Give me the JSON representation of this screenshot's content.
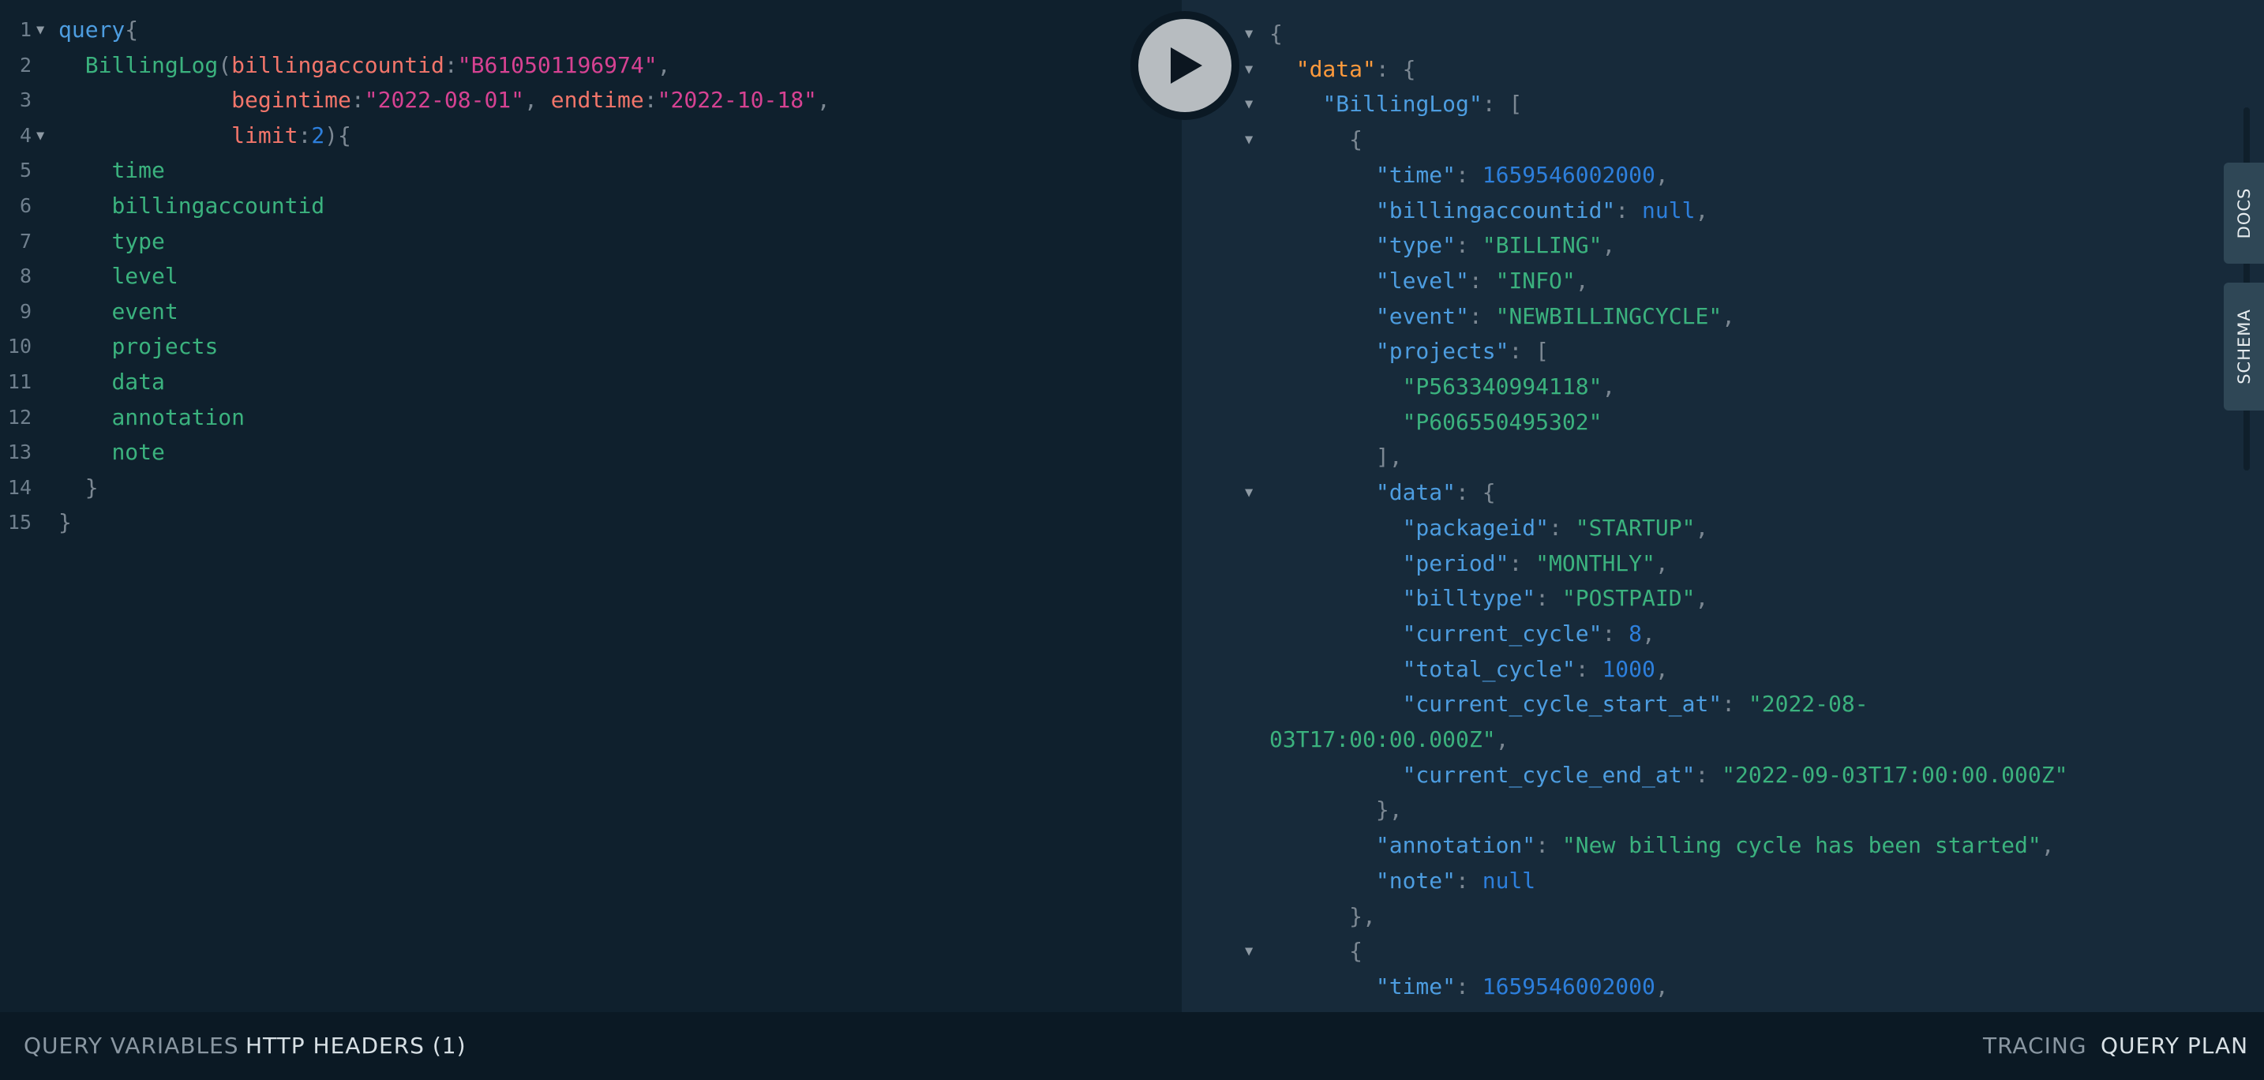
{
  "editor": {
    "lines": [
      {
        "n": "1",
        "fold": true,
        "tokens": [
          [
            "query",
            "c-key"
          ],
          [
            "{",
            "c-punc"
          ]
        ]
      },
      {
        "n": "2",
        "fold": false,
        "tokens": [
          [
            "  ",
            ""
          ],
          [
            "BillingLog",
            "c-op"
          ],
          [
            "(",
            "c-punc"
          ],
          [
            "billingaccountid",
            "c-arg"
          ],
          [
            ":",
            "c-punc"
          ],
          [
            "\"B610501196974\"",
            "c-str"
          ],
          [
            ",",
            "c-punc"
          ]
        ]
      },
      {
        "n": "3",
        "fold": false,
        "tokens": [
          [
            "             ",
            ""
          ],
          [
            "begintime",
            "c-arg"
          ],
          [
            ":",
            "c-punc"
          ],
          [
            "\"2022-08-01\"",
            "c-str"
          ],
          [
            ", ",
            "c-punc"
          ],
          [
            "endtime",
            "c-arg"
          ],
          [
            ":",
            "c-punc"
          ],
          [
            "\"2022-10-18\"",
            "c-str"
          ],
          [
            ",",
            "c-punc"
          ]
        ]
      },
      {
        "n": "4",
        "fold": true,
        "tokens": [
          [
            "             ",
            ""
          ],
          [
            "limit",
            "c-arg"
          ],
          [
            ":",
            "c-punc"
          ],
          [
            "2",
            "c-num"
          ],
          [
            "){",
            "c-punc"
          ]
        ]
      },
      {
        "n": "5",
        "fold": false,
        "tokens": [
          [
            "    ",
            ""
          ],
          [
            "time",
            "c-field"
          ]
        ]
      },
      {
        "n": "6",
        "fold": false,
        "tokens": [
          [
            "    ",
            ""
          ],
          [
            "billingaccountid",
            "c-field"
          ]
        ]
      },
      {
        "n": "7",
        "fold": false,
        "tokens": [
          [
            "    ",
            ""
          ],
          [
            "type",
            "c-field"
          ]
        ]
      },
      {
        "n": "8",
        "fold": false,
        "tokens": [
          [
            "    ",
            ""
          ],
          [
            "level",
            "c-field"
          ]
        ]
      },
      {
        "n": "9",
        "fold": false,
        "tokens": [
          [
            "    ",
            ""
          ],
          [
            "event",
            "c-field"
          ]
        ]
      },
      {
        "n": "10",
        "fold": false,
        "tokens": [
          [
            "    ",
            ""
          ],
          [
            "projects",
            "c-field"
          ]
        ]
      },
      {
        "n": "11",
        "fold": false,
        "tokens": [
          [
            "    ",
            ""
          ],
          [
            "data",
            "c-field"
          ]
        ]
      },
      {
        "n": "12",
        "fold": false,
        "tokens": [
          [
            "    ",
            ""
          ],
          [
            "annotation",
            "c-field"
          ]
        ]
      },
      {
        "n": "13",
        "fold": false,
        "tokens": [
          [
            "    ",
            ""
          ],
          [
            "note",
            "c-field"
          ]
        ]
      },
      {
        "n": "14",
        "fold": false,
        "tokens": [
          [
            "  ",
            ""
          ],
          [
            "}",
            "c-punc"
          ]
        ]
      },
      {
        "n": "15",
        "fold": false,
        "tokens": [
          [
            "}",
            "c-punc"
          ]
        ]
      }
    ]
  },
  "result": {
    "lines": [
      {
        "fold": true,
        "tokens": [
          [
            "{",
            "j-punc"
          ]
        ]
      },
      {
        "fold": true,
        "tokens": [
          [
            "  ",
            ""
          ],
          [
            "\"data\"",
            "j-key-top"
          ],
          [
            ": {",
            "j-punc"
          ]
        ]
      },
      {
        "fold": true,
        "tokens": [
          [
            "    ",
            ""
          ],
          [
            "\"BillingLog\"",
            "j-key"
          ],
          [
            ": [",
            "j-punc"
          ]
        ]
      },
      {
        "fold": true,
        "tokens": [
          [
            "      ",
            ""
          ],
          [
            "{",
            "j-punc"
          ]
        ]
      },
      {
        "fold": false,
        "tokens": [
          [
            "        ",
            ""
          ],
          [
            "\"time\"",
            "j-key"
          ],
          [
            ": ",
            "j-punc"
          ],
          [
            "1659546002000",
            "j-num"
          ],
          [
            ",",
            "j-punc"
          ]
        ]
      },
      {
        "fold": false,
        "tokens": [
          [
            "        ",
            ""
          ],
          [
            "\"billingaccountid\"",
            "j-key"
          ],
          [
            ": ",
            "j-punc"
          ],
          [
            "null",
            "j-null"
          ],
          [
            ",",
            "j-punc"
          ]
        ]
      },
      {
        "fold": false,
        "tokens": [
          [
            "        ",
            ""
          ],
          [
            "\"type\"",
            "j-key"
          ],
          [
            ": ",
            "j-punc"
          ],
          [
            "\"BILLING\"",
            "j-str"
          ],
          [
            ",",
            "j-punc"
          ]
        ]
      },
      {
        "fold": false,
        "tokens": [
          [
            "        ",
            ""
          ],
          [
            "\"level\"",
            "j-key"
          ],
          [
            ": ",
            "j-punc"
          ],
          [
            "\"INFO\"",
            "j-str"
          ],
          [
            ",",
            "j-punc"
          ]
        ]
      },
      {
        "fold": false,
        "tokens": [
          [
            "        ",
            ""
          ],
          [
            "\"event\"",
            "j-key"
          ],
          [
            ": ",
            "j-punc"
          ],
          [
            "\"NEWBILLINGCYCLE\"",
            "j-str"
          ],
          [
            ",",
            "j-punc"
          ]
        ]
      },
      {
        "fold": false,
        "tokens": [
          [
            "        ",
            ""
          ],
          [
            "\"projects\"",
            "j-key"
          ],
          [
            ": [",
            "j-punc"
          ]
        ]
      },
      {
        "fold": false,
        "tokens": [
          [
            "          ",
            ""
          ],
          [
            "\"P563340994118\"",
            "j-str"
          ],
          [
            ",",
            "j-punc"
          ]
        ]
      },
      {
        "fold": false,
        "tokens": [
          [
            "          ",
            ""
          ],
          [
            "\"P606550495302\"",
            "j-str"
          ]
        ]
      },
      {
        "fold": false,
        "tokens": [
          [
            "        ",
            ""
          ],
          [
            "],",
            "j-punc"
          ]
        ]
      },
      {
        "fold": true,
        "tokens": [
          [
            "        ",
            ""
          ],
          [
            "\"data\"",
            "j-key"
          ],
          [
            ": {",
            "j-punc"
          ]
        ]
      },
      {
        "fold": false,
        "tokens": [
          [
            "          ",
            ""
          ],
          [
            "\"packageid\"",
            "j-key"
          ],
          [
            ": ",
            "j-punc"
          ],
          [
            "\"STARTUP\"",
            "j-str"
          ],
          [
            ",",
            "j-punc"
          ]
        ]
      },
      {
        "fold": false,
        "tokens": [
          [
            "          ",
            ""
          ],
          [
            "\"period\"",
            "j-key"
          ],
          [
            ": ",
            "j-punc"
          ],
          [
            "\"MONTHLY\"",
            "j-str"
          ],
          [
            ",",
            "j-punc"
          ]
        ]
      },
      {
        "fold": false,
        "tokens": [
          [
            "          ",
            ""
          ],
          [
            "\"billtype\"",
            "j-key"
          ],
          [
            ": ",
            "j-punc"
          ],
          [
            "\"POSTPAID\"",
            "j-str"
          ],
          [
            ",",
            "j-punc"
          ]
        ]
      },
      {
        "fold": false,
        "tokens": [
          [
            "          ",
            ""
          ],
          [
            "\"current_cycle\"",
            "j-key"
          ],
          [
            ": ",
            "j-punc"
          ],
          [
            "8",
            "j-num"
          ],
          [
            ",",
            "j-punc"
          ]
        ]
      },
      {
        "fold": false,
        "tokens": [
          [
            "          ",
            ""
          ],
          [
            "\"total_cycle\"",
            "j-key"
          ],
          [
            ": ",
            "j-punc"
          ],
          [
            "1000",
            "j-num"
          ],
          [
            ",",
            "j-punc"
          ]
        ]
      },
      {
        "fold": false,
        "tokens": [
          [
            "          ",
            ""
          ],
          [
            "\"current_cycle_start_at\"",
            "j-key"
          ],
          [
            ": ",
            "j-punc"
          ],
          [
            "\"2022-08-",
            "j-str"
          ]
        ]
      },
      {
        "fold": false,
        "tokens": [
          [
            "03T17:00:00.000Z\"",
            "j-str"
          ],
          [
            ",",
            "j-punc"
          ]
        ]
      },
      {
        "fold": false,
        "tokens": [
          [
            "          ",
            ""
          ],
          [
            "\"current_cycle_end_at\"",
            "j-key"
          ],
          [
            ": ",
            "j-punc"
          ],
          [
            "\"2022-09-03T17:00:00.000Z\"",
            "j-str"
          ]
        ]
      },
      {
        "fold": false,
        "tokens": [
          [
            "        ",
            ""
          ],
          [
            "},",
            "j-punc"
          ]
        ]
      },
      {
        "fold": false,
        "tokens": [
          [
            "        ",
            ""
          ],
          [
            "\"annotation\"",
            "j-key"
          ],
          [
            ": ",
            "j-punc"
          ],
          [
            "\"New billing cycle has been started\"",
            "j-str"
          ],
          [
            ",",
            "j-punc"
          ]
        ]
      },
      {
        "fold": false,
        "tokens": [
          [
            "        ",
            ""
          ],
          [
            "\"note\"",
            "j-key"
          ],
          [
            ": ",
            "j-punc"
          ],
          [
            "null",
            "j-null"
          ]
        ]
      },
      {
        "fold": false,
        "tokens": [
          [
            "      ",
            ""
          ],
          [
            "},",
            "j-punc"
          ]
        ]
      },
      {
        "fold": true,
        "tokens": [
          [
            "      ",
            ""
          ],
          [
            "{",
            "j-punc"
          ]
        ]
      },
      {
        "fold": false,
        "tokens": [
          [
            "        ",
            ""
          ],
          [
            "\"time\"",
            "j-key"
          ],
          [
            ": ",
            "j-punc"
          ],
          [
            "1659546002000",
            "j-num"
          ],
          [
            ",",
            "j-punc"
          ]
        ]
      }
    ]
  },
  "side_tabs": {
    "docs": "DOCS",
    "schema": "SCHEMA"
  },
  "bottom_bar": {
    "query_variables": "QUERY VARIABLES",
    "http_headers": "HTTP HEADERS (1)",
    "tracing": "TRACING",
    "query_plan": "QUERY PLAN"
  },
  "icons": {
    "run": "play-icon",
    "fold": "fold-arrow-icon"
  },
  "colors": {
    "editor_bg": "#0f202d",
    "result_bg": "#172a3a",
    "bottom_bar_bg": "#0b1924",
    "keyword": "#4d9de0",
    "field": "#3bb27e",
    "argument": "#f2756a",
    "string_arg": "#d64292",
    "number": "#2d7fdc"
  }
}
